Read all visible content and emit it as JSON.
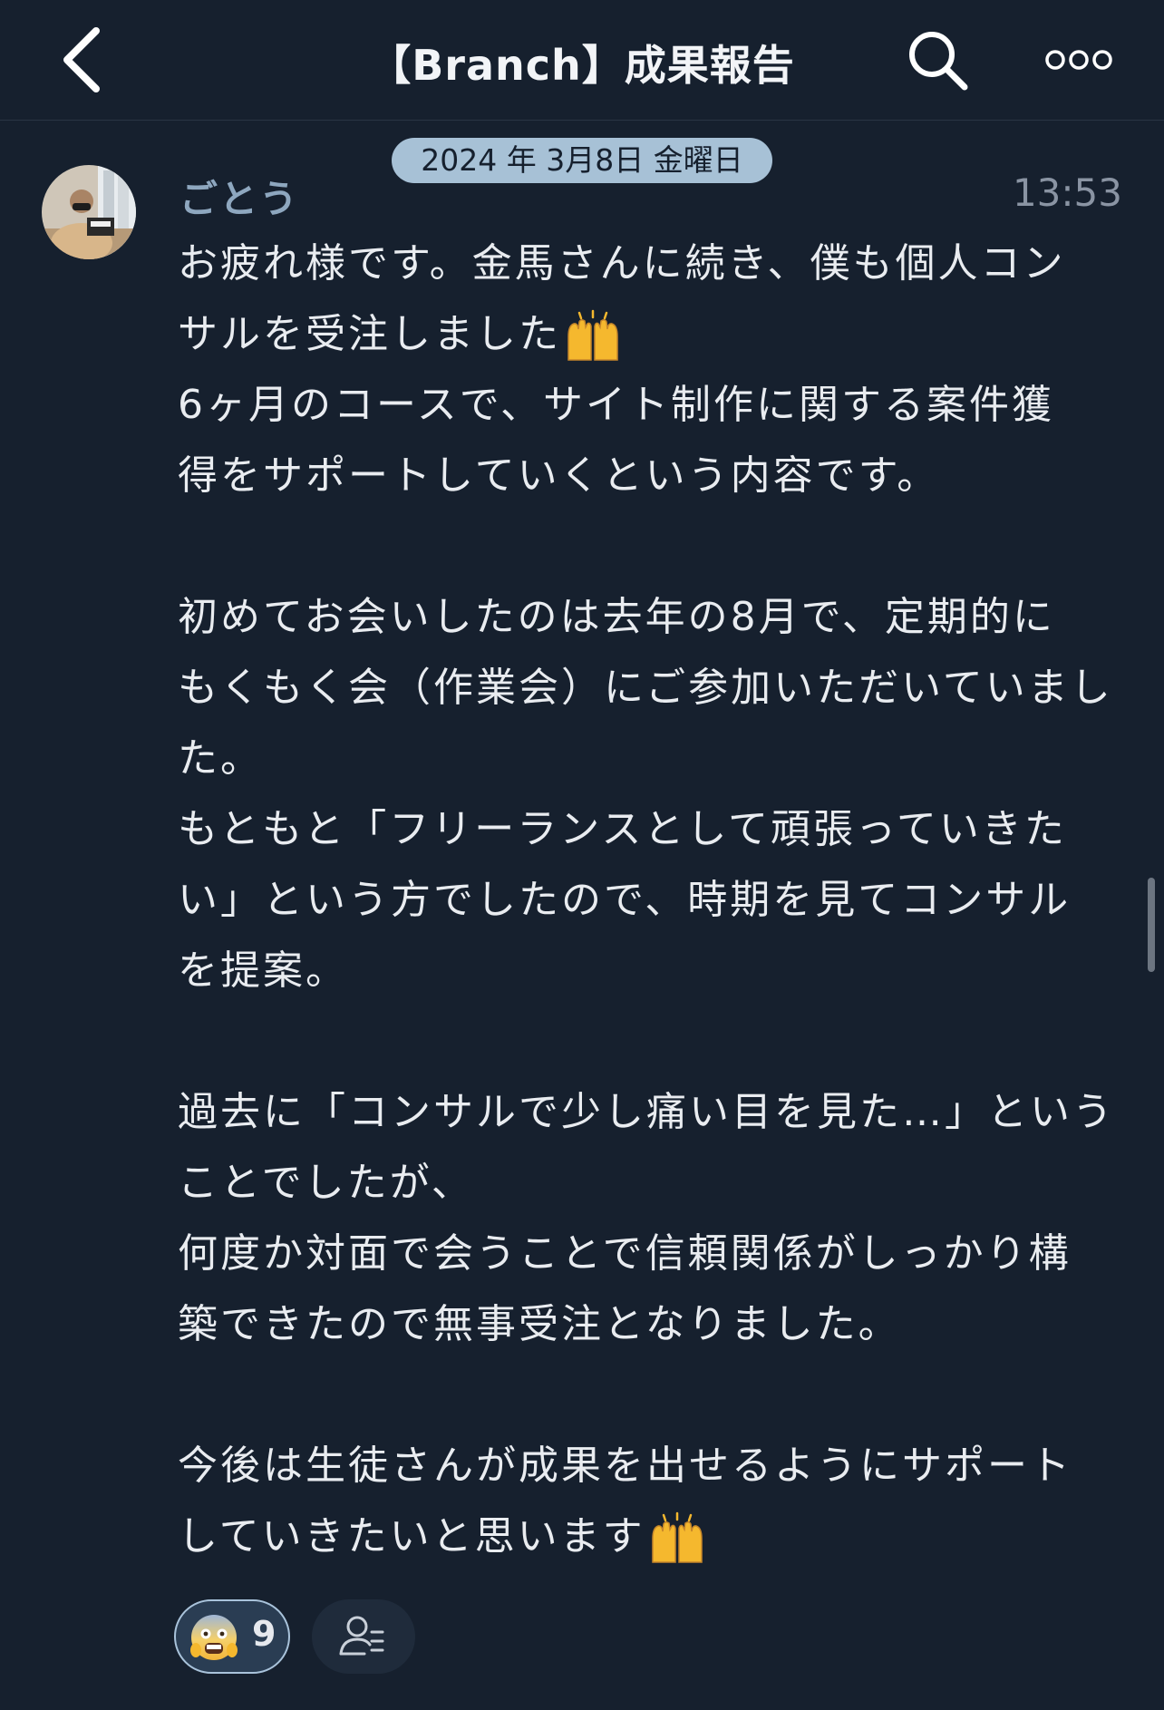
{
  "header": {
    "title": "【Branch】成果報告",
    "back_icon": "chevron-left-icon",
    "search_icon": "search-icon",
    "more_icon": "more-dots-icon"
  },
  "date_separator": "2024 年 3月8日 金曜日",
  "message": {
    "sender": "ごとう",
    "time": "13:53",
    "lines": [
      "お疲れ様です。金馬さんに続き、僕も個人コン",
      "サルを受注しました",
      "6ヶ月のコースで、サイト制作に関する案件獲",
      "得をサポートしていくという内容です。",
      "",
      "初めてお会いしたのは去年の8月で、定期的に",
      "もくもく会（作業会）にご参加いただいていまし",
      "た。",
      "もともと「フリーランスとして頑張っていきた",
      "い」という方でしたので、時期を見てコンサル",
      "を提案。",
      "",
      "過去に「コンサルで少し痛い目を見た…」という",
      "ことでしたが、",
      "何度か対面で会うことで信頼関係がしっかり構",
      "築できたので無事受注となりました。",
      "",
      "今後は生徒さんが成果を出せるようにサポート",
      "していきたいと思います"
    ]
  },
  "reactions": {
    "count": "9",
    "emoji": "scared-face-icon",
    "read_icon": "read-by-person-icon"
  },
  "colors": {
    "background": "#16202e",
    "date_pill": "#a7c1d6",
    "sender_name": "#8ea7bf",
    "reaction_border": "#a9c3db",
    "emoji_yellow": "#f5b82e"
  }
}
